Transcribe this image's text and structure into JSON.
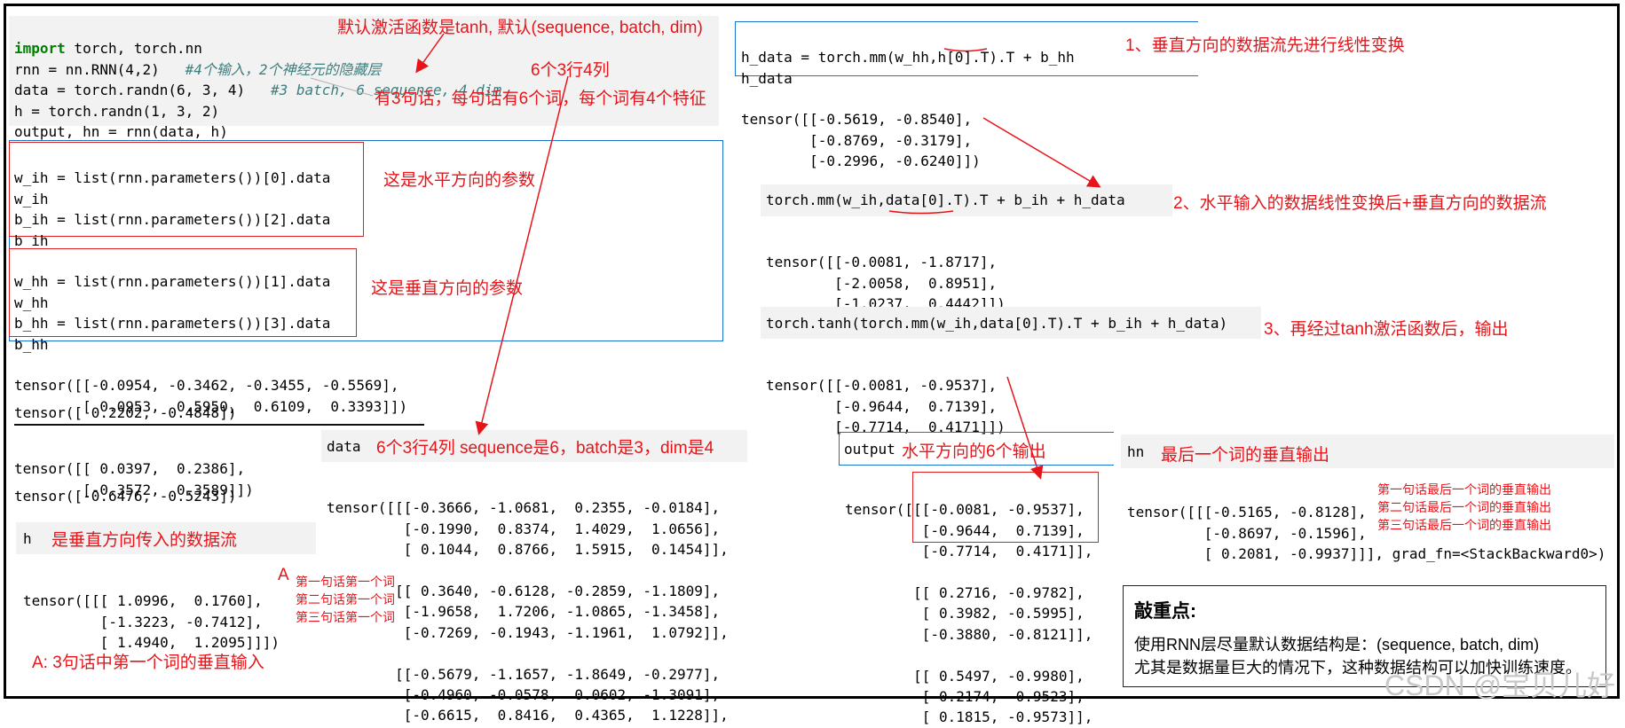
{
  "code": {
    "main_block": [
      [
        "import",
        " torch, torch.nn"
      ],
      [
        "rnn = nn.RNN(4,2)   ",
        "#4个输入，2个神经元的隐藏层"
      ],
      [
        "data = torch.randn(6, 3, 4)   ",
        "#3 batch, 6 sequence, 4 dim"
      ],
      [
        "h = torch.randn(1, 3, 2)",
        ""
      ],
      [
        "output, hn = rnn(data, h)",
        ""
      ]
    ],
    "wih_block": [
      "w_ih = list(rnn.parameters())[0].data",
      "w_ih",
      "b_ih = list(rnn.parameters())[2].data",
      "b_ih"
    ],
    "whh_block": [
      "w_hh = list(rnn.parameters())[1].data",
      "w_hh",
      "b_hh = list(rnn.parameters())[3].data",
      "b_hh"
    ],
    "wih_output": [
      "tensor([[-0.0954, -0.3462, -0.3455, -0.5569],",
      "        [ 0.0953,  0.5950,  0.6109,  0.3393]])"
    ],
    "bih_output": [
      "tensor([ 0.2202, -0.4848])"
    ],
    "whh_output": [
      "tensor([[ 0.0397,  0.2386],",
      "        [-0.3572,  0.3589]])"
    ],
    "bhh_output": [
      "tensor([-0.6476, -0.5243])"
    ],
    "h_cell": "h",
    "h_output": [
      "tensor([[[ 1.0996,  0.1760],",
      "         [-1.3223, -0.7412],",
      "         [ 1.4940,  1.2095]]])"
    ],
    "data_cell": "data",
    "data_output": [
      "tensor([[[-0.3666, -1.0681,  0.2355, -0.0184],",
      "         [-0.1990,  0.8374,  1.4029,  1.0656],",
      "         [ 0.1044,  0.8766,  1.5915,  0.1454]],",
      "",
      "        [[ 0.3640, -0.6128, -0.2859, -1.1809],",
      "         [-1.9658,  1.7206, -1.0865, -1.3458],",
      "         [-0.7269, -0.1943, -1.1961,  1.0792]],",
      "",
      "        [[-0.5679, -1.1657, -1.8649, -0.2977],",
      "         [-0.4960, -0.0578,  0.0602, -1.3091],",
      "         [-0.6615,  0.8416,  0.4365,  1.1228]],"
    ],
    "hdata_cell": [
      "h_data = torch.mm(w_hh,h[0].T).T + b_hh",
      "h_data"
    ],
    "hdata_output": [
      "tensor([[-0.5619, -0.8540],",
      "        [-0.8769, -0.3179],",
      "        [-0.2996, -0.6240]])"
    ],
    "step2_cell": "torch.mm(w_ih,data[0].T).T + b_ih + h_data",
    "step2_output": [
      "tensor([[-0.0081, -1.8717],",
      "        [-2.0058,  0.8951],",
      "        [-1.0237,  0.4442]])"
    ],
    "step3_cell": "torch.tanh(torch.mm(w_ih,data[0].T).T + b_ih + h_data)",
    "step3_output": [
      "tensor([[-0.0081, -0.9537],",
      "        [-0.9644,  0.7139],",
      "        [-0.7714,  0.4171]])"
    ],
    "output_cell": "output",
    "output_output": [
      "tensor([[[-0.0081, -0.9537],",
      "         [-0.9644,  0.7139],",
      "         [-0.7714,  0.4171]],",
      "",
      "        [[ 0.2716, -0.9782],",
      "         [ 0.3982, -0.5995],",
      "         [-0.3880, -0.8121]],",
      "",
      "        [[ 0.5497, -0.9980],",
      "         [ 0.2174, -0.9523],",
      "         [ 0.1815, -0.9573]],"
    ],
    "hn_cell": "hn",
    "hn_output": [
      "tensor([[[-0.5165, -0.8128],",
      "         [-0.8697, -0.1596],",
      "         [ 0.2081, -0.9937]]], grad_fn=<StackBackward0>)"
    ]
  },
  "annotations": {
    "default_activation": "默认激活函数是tanh, 默认(sequence, batch, dim)",
    "six_by_three_four": "6个3行4列",
    "three_sentences": "有3句话，每句话有6个词，每个词有4个特征",
    "horizontal_params": "这是水平方向的参数",
    "vertical_params": "这是垂直方向的参数",
    "h_is_vertical_input": "是垂直方向传入的数据流",
    "label_A": "A",
    "h_row1": "第一句话第一个词",
    "h_row2": "第二句话第一个词",
    "h_row3": "第三句话第一个词",
    "A_explain": "A: 3句话中第一个词的垂直输入",
    "data_explain": "6个3行4列   sequence是6，batch是3，dim是4",
    "step1": "1、垂直方向的数据流先进行线性变换",
    "step2": "2、水平输入的数据线性变换后+垂直方向的数据流",
    "step3": "3、再经过tanh激活函数后，输出",
    "output_explain": "水平方向的6个输出",
    "hn_explain": "最后一个词的垂直输出",
    "hn_row1": "第一句话最后一个词的垂直输出",
    "hn_row2": "第二句话最后一个词的垂直输出",
    "hn_row3": "第三句话最后一个词的垂直输出"
  },
  "summary": {
    "title": "敲重点:",
    "line1": "使用RNN层尽量默认数据结构是：(sequence, batch, dim)",
    "line2": "尤其是数据量巨大的情况下，这种数据结构可以加快训练速度。"
  },
  "watermark": "CSDN @宝贝儿好",
  "colors": {
    "annotation": "#e8141a",
    "frame_blue": "#1a73c8",
    "code_bg": "#f2f2f2"
  }
}
